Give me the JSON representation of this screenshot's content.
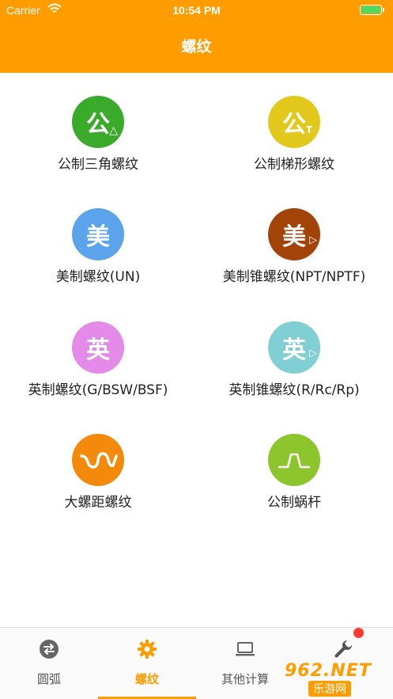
{
  "status_bar": {
    "carrier": "Carrier",
    "time": "10:54 PM"
  },
  "nav": {
    "title": "螺纹"
  },
  "items": [
    {
      "label": "公制三角螺纹",
      "glyph": "公",
      "sub": "△",
      "color": "#3aaa2a",
      "icon": "metric-triangle-icon"
    },
    {
      "label": "公制梯形螺纹",
      "glyph": "公",
      "sub": "T",
      "color": "#e3c81c",
      "icon": "metric-trapezoid-icon"
    },
    {
      "label": "美制螺纹(UN)",
      "glyph": "美",
      "sub": "",
      "color": "#5ba4ec",
      "icon": "us-thread-icon"
    },
    {
      "label": "美制锥螺纹(NPT/NPTF)",
      "glyph": "美",
      "sub": "▷",
      "color": "#a24307",
      "icon": "us-taper-thread-icon"
    },
    {
      "label": "英制螺纹(G/BSW/BSF)",
      "glyph": "英",
      "sub": "",
      "color": "#e48ae8",
      "icon": "imperial-thread-icon"
    },
    {
      "label": "英制锥螺纹(R/Rc/Rp)",
      "glyph": "英",
      "sub": "▷",
      "color": "#7fcfd3",
      "icon": "imperial-taper-thread-icon"
    },
    {
      "label": "大螺距螺纹",
      "glyph": "",
      "sub": "",
      "color": "#f38a0c",
      "icon": "wave-icon"
    },
    {
      "label": "公制蜗杆",
      "glyph": "",
      "sub": "",
      "color": "#8dc62c",
      "icon": "worm-profile-icon"
    }
  ],
  "tabs": [
    {
      "label": "圆弧",
      "icon": "swap-icon",
      "active": false
    },
    {
      "label": "螺纹",
      "icon": "gear-icon",
      "active": true
    },
    {
      "label": "其他计算",
      "icon": "laptop-icon",
      "active": false
    },
    {
      "label": "",
      "icon": "wrench-icon",
      "active": false
    }
  ],
  "watermark": {
    "top": "962.NET",
    "bottom": "乐游网"
  },
  "colors": {
    "accent": "#ff9c00",
    "badge": "#ff3b30"
  }
}
